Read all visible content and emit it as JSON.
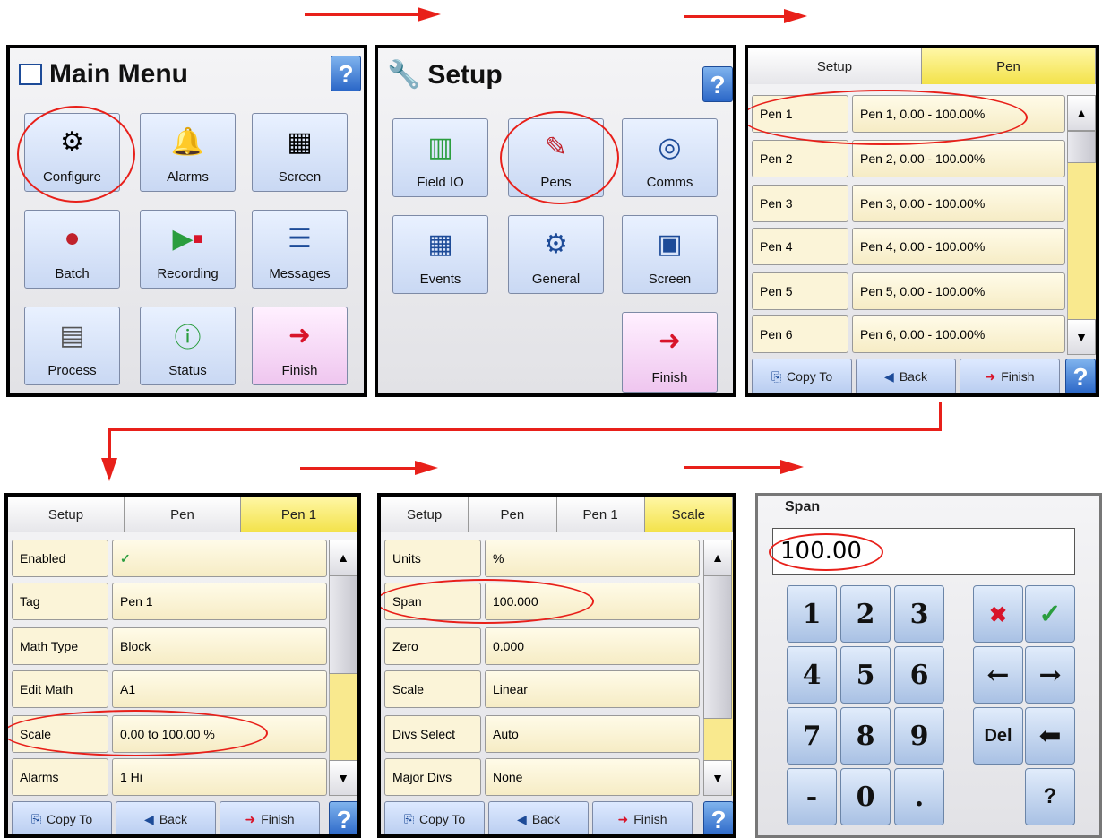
{
  "main_menu": {
    "title": "Main Menu",
    "help": "?",
    "tiles": [
      {
        "label": "Configure",
        "icon": "configure-icon"
      },
      {
        "label": "Alarms",
        "icon": "bell-icon"
      },
      {
        "label": "Screen",
        "icon": "screen-icon"
      },
      {
        "label": "Batch",
        "icon": "batch-icon"
      },
      {
        "label": "Recording",
        "icon": "recording-icon"
      },
      {
        "label": "Messages",
        "icon": "messages-icon"
      },
      {
        "label": "Process",
        "icon": "calculator-icon"
      },
      {
        "label": "Status",
        "icon": "info-icon"
      },
      {
        "label": "Finish",
        "icon": "exit-door-icon"
      }
    ]
  },
  "setup_menu": {
    "title": "Setup",
    "help": "?",
    "tiles": [
      {
        "label": "Field IO",
        "icon": "field-io-icon"
      },
      {
        "label": "Pens",
        "icon": "pens-icon"
      },
      {
        "label": "Comms",
        "icon": "comms-icon"
      },
      {
        "label": "Events",
        "icon": "events-icon"
      },
      {
        "label": "General",
        "icon": "gears-icon"
      },
      {
        "label": "Screen",
        "icon": "screen-icon"
      },
      {
        "label": "Finish",
        "icon": "exit-door-icon"
      }
    ]
  },
  "pen_list": {
    "breadcrumb": [
      "Setup",
      "Pen"
    ],
    "rows": [
      {
        "key": "Pen 1",
        "value": "Pen 1, 0.00 - 100.00%"
      },
      {
        "key": "Pen 2",
        "value": "Pen 2, 0.00 - 100.00%"
      },
      {
        "key": "Pen 3",
        "value": "Pen 3, 0.00 - 100.00%"
      },
      {
        "key": "Pen 4",
        "value": "Pen 4, 0.00 - 100.00%"
      },
      {
        "key": "Pen 5",
        "value": "Pen 5, 0.00 - 100.00%"
      },
      {
        "key": "Pen 6",
        "value": "Pen 6, 0.00 - 100.00%"
      }
    ],
    "bottom": {
      "copy_to": "Copy To",
      "back": "Back",
      "finish": "Finish",
      "help": "?"
    }
  },
  "pen1_settings": {
    "breadcrumb": [
      "Setup",
      "Pen",
      "Pen 1"
    ],
    "rows": [
      {
        "key": "Enabled",
        "value": "✓"
      },
      {
        "key": "Tag",
        "value": "Pen 1"
      },
      {
        "key": "Math Type",
        "value": "Block"
      },
      {
        "key": "Edit Math",
        "value": "A1"
      },
      {
        "key": "Scale",
        "value": "0.00 to 100.00 %"
      },
      {
        "key": "Alarms",
        "value": "1 Hi"
      }
    ],
    "bottom": {
      "copy_to": "Copy To",
      "back": "Back",
      "finish": "Finish",
      "help": "?"
    }
  },
  "scale_settings": {
    "breadcrumb": [
      "Setup",
      "Pen",
      "Pen 1",
      "Scale"
    ],
    "rows": [
      {
        "key": "Units",
        "value": "%"
      },
      {
        "key": "Span",
        "value": "100.000"
      },
      {
        "key": "Zero",
        "value": "0.000"
      },
      {
        "key": "Scale",
        "value": "Linear"
      },
      {
        "key": "Divs Select",
        "value": "Auto"
      },
      {
        "key": "Major Divs",
        "value": "None"
      }
    ],
    "bottom": {
      "copy_to": "Copy To",
      "back": "Back",
      "finish": "Finish",
      "help": "?"
    }
  },
  "span_keypad": {
    "title": "Span",
    "value": "100.00",
    "digits": [
      "1",
      "2",
      "3",
      "4",
      "5",
      "6",
      "7",
      "8",
      "9",
      "-",
      "0",
      "."
    ],
    "cancel": "✖",
    "ok": "✓",
    "left": "←",
    "right": "→",
    "del": "Del",
    "backspace": "⬅",
    "help": "?"
  }
}
